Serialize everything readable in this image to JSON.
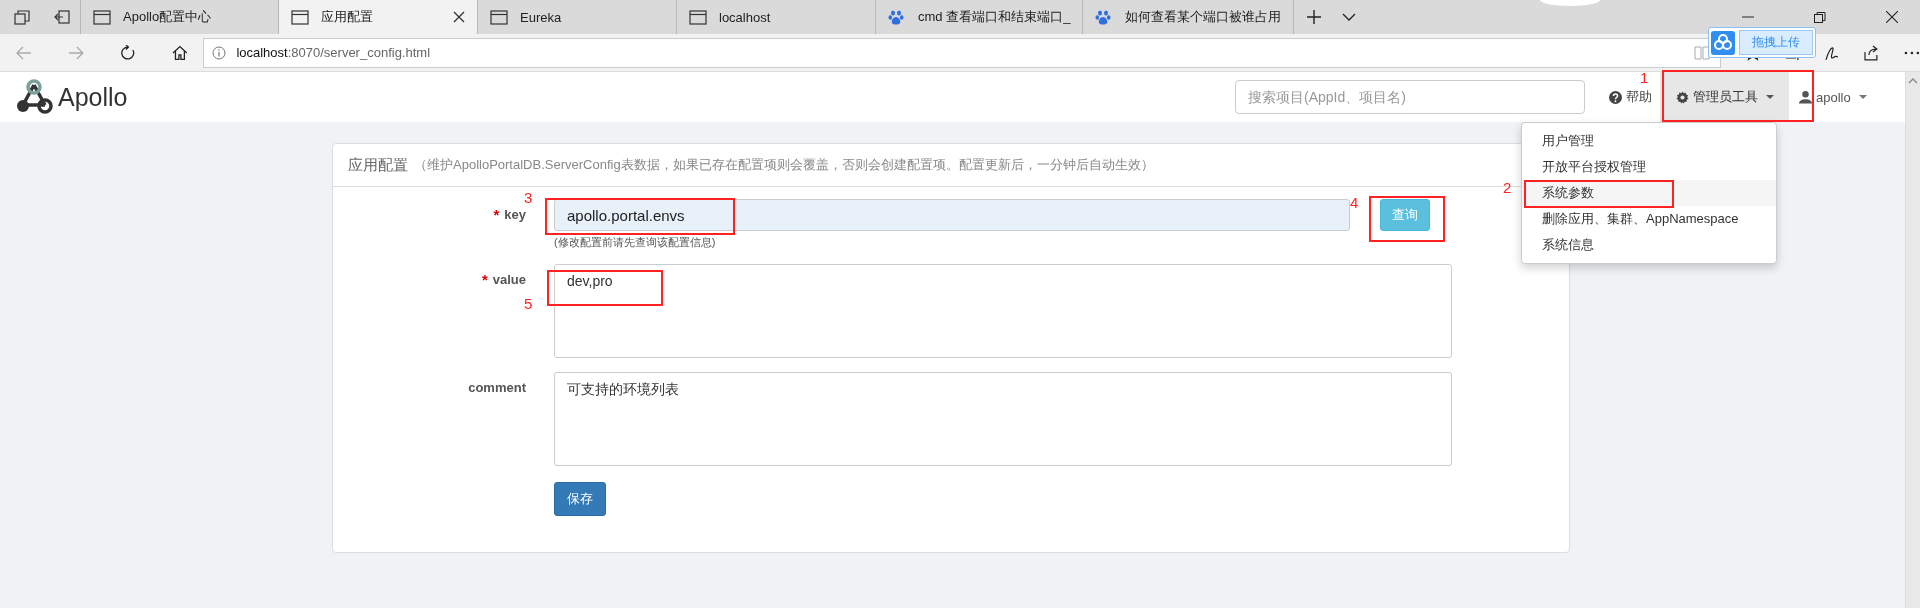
{
  "browser": {
    "tabs": [
      {
        "title": "Apollo配置中心",
        "kind": "page",
        "selected": false
      },
      {
        "title": "应用配置",
        "kind": "page",
        "selected": true
      },
      {
        "title": "Eureka",
        "kind": "page",
        "selected": false
      },
      {
        "title": "localhost",
        "kind": "page",
        "selected": false
      },
      {
        "title": "cmd 查看端口和结束端口_",
        "kind": "paw",
        "selected": false
      },
      {
        "title": "如何查看某个端口被谁占用",
        "kind": "paw",
        "selected": false
      }
    ],
    "address": {
      "host": "localhost",
      "rest": ":8070/server_config.html"
    },
    "upload_badge": "拖拽上传"
  },
  "header": {
    "logo": "Apollo",
    "search": {
      "placeholder": "搜索项目(AppId、项目名)"
    },
    "help": "帮助",
    "admin_menu": {
      "label": "管理员工具",
      "expanded": true,
      "items": [
        {
          "label": "用户管理",
          "selected": false
        },
        {
          "label": "开放平台授权管理",
          "selected": false
        },
        {
          "label": "系统参数",
          "selected": true
        },
        {
          "label": "删除应用、集群、AppNamespace",
          "selected": false
        },
        {
          "label": "系统信息",
          "selected": false
        }
      ]
    },
    "user": "apollo"
  },
  "panel": {
    "title": "应用配置",
    "subtitle": "（维护ApolloPortalDB.ServerConfig表数据，如果已存在配置项则会覆盖，否则会创建配置项。配置更新后，一分钟后自动生效）",
    "fields": [
      {
        "kind": "input",
        "label": "key",
        "required_mark": "*",
        "value": "apollo.portal.envs",
        "hint": "(修改配置前请先查询该配置信息)",
        "button": "查询"
      },
      {
        "kind": "textarea",
        "label": "value",
        "required_mark": "*",
        "value": "dev,pro"
      },
      {
        "kind": "textarea",
        "label": "comment",
        "value": "可支持的环境列表"
      }
    ],
    "save": "保存"
  },
  "annotations": [
    {
      "number": "1"
    },
    {
      "number": "2"
    },
    {
      "number": "3"
    },
    {
      "number": "4"
    },
    {
      "number": "5"
    }
  ]
}
